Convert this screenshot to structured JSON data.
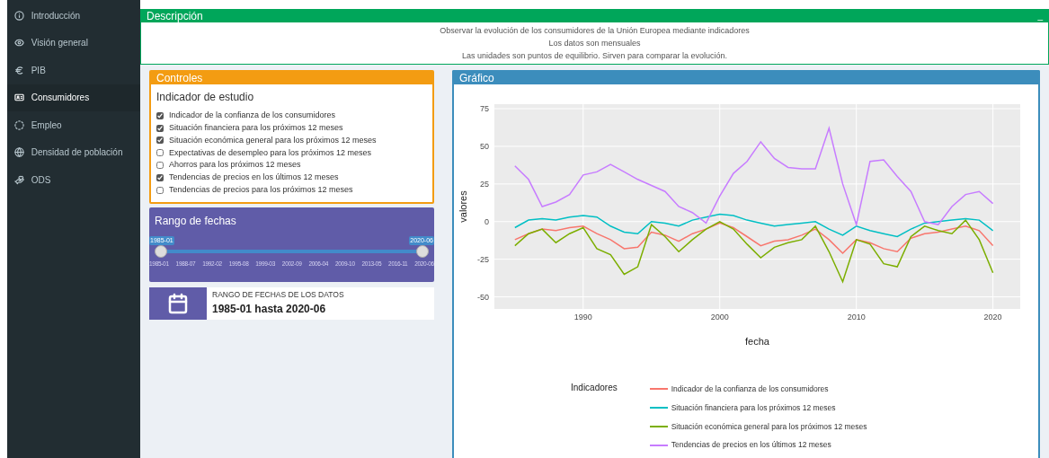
{
  "sidebar": {
    "items": [
      {
        "label": "Introducción",
        "selected": false
      },
      {
        "label": "Visión general",
        "selected": false
      },
      {
        "label": "PIB",
        "selected": false
      },
      {
        "label": "Consumidores",
        "selected": true
      },
      {
        "label": "Empleo",
        "selected": false
      },
      {
        "label": "Densidad de población",
        "selected": false
      },
      {
        "label": "ODS",
        "selected": false
      }
    ]
  },
  "description": {
    "title": "Descripción",
    "collapse_icon": "_",
    "lines": [
      "Observar la evolución de los consumidores de la Unión Europea mediante indicadores",
      "Los datos son mensuales",
      "Las unidades son puntos de equilibrio. Sirven para comparar la evolución."
    ]
  },
  "controls": {
    "title": "Controles",
    "heading": "Indicador de estudio",
    "options": [
      {
        "label": "Indicador de la confianza de los consumidores",
        "checked": true
      },
      {
        "label": "Situación financiera para los próximos 12 meses",
        "checked": true
      },
      {
        "label": "Situación económica general para los próximos 12 meses",
        "checked": true
      },
      {
        "label": "Expectativas de desempleo para los próximos 12 meses",
        "checked": false
      },
      {
        "label": "Ahorros para los próximos 12 meses",
        "checked": false
      },
      {
        "label": "Tendencias de precios en los últimos 12 meses",
        "checked": true
      },
      {
        "label": "Tendencias de precios para los próximos 12 meses",
        "checked": false
      }
    ]
  },
  "date_range": {
    "title": "Rango de fechas",
    "from": "1985-01",
    "to": "2020-06",
    "ticks": [
      "1985-01",
      "1988-07",
      "1992-02",
      "1995-08",
      "1999-03",
      "2002-09",
      "2006-04",
      "2009-10",
      "2013-05",
      "2016-11",
      "2020-06"
    ]
  },
  "info_box": {
    "label": "RANGO DE FECHAS DE LOS DATOS",
    "value": "1985-01 hasta 2020-06"
  },
  "chart_panel": {
    "title": "Gráfico",
    "legend_title": "Indicadores",
    "chart_data": {
      "type": "line",
      "grid": true,
      "xlabel": "fecha",
      "ylabel": "valores",
      "xlim": [
        1983.5,
        2022
      ],
      "ylim": [
        -58,
        78
      ],
      "xticks": [
        1990,
        2000,
        2010,
        2020
      ],
      "yticks": [
        -50,
        -25,
        0,
        25,
        50,
        75
      ],
      "x": [
        1985,
        1986,
        1987,
        1988,
        1989,
        1990,
        1991,
        1992,
        1993,
        1994,
        1995,
        1996,
        1997,
        1998,
        1999,
        2000,
        2001,
        2002,
        2003,
        2004,
        2005,
        2006,
        2007,
        2008,
        2009,
        2010,
        2011,
        2012,
        2013,
        2014,
        2015,
        2016,
        2017,
        2018,
        2019,
        2020
      ],
      "series": [
        {
          "name": "Indicador de la confianza de los consumidores",
          "color": "#f8766d",
          "values": [
            -12,
            -8,
            -5,
            -6,
            -4,
            -3,
            -8,
            -12,
            -18,
            -17,
            -7,
            -9,
            -13,
            -8,
            -5,
            -1,
            -4,
            -10,
            -16,
            -13,
            -12,
            -9,
            -5,
            -12,
            -21,
            -12,
            -14,
            -18,
            -20,
            -11,
            -8,
            -7,
            -5,
            -3,
            -6,
            -16
          ]
        },
        {
          "name": "Situación financiera para los próximos 12 meses",
          "color": "#00bfc4",
          "values": [
            -4,
            1,
            2,
            1,
            3,
            4,
            3,
            -3,
            -7,
            -8,
            0,
            -1,
            -3,
            1,
            3,
            5,
            4,
            1,
            -1,
            -3,
            -2,
            -1,
            0,
            -5,
            -9,
            -3,
            -6,
            -8,
            -10,
            -5,
            -1,
            0,
            1,
            2,
            1,
            -6
          ]
        },
        {
          "name": "Situación económica general para los próximos 12 meses",
          "color": "#7cae00",
          "values": [
            -16,
            -8,
            -5,
            -14,
            -8,
            -4,
            -18,
            -22,
            -35,
            -30,
            -2,
            -10,
            -20,
            -12,
            -5,
            0,
            -5,
            -15,
            -24,
            -17,
            -14,
            -12,
            -3,
            -20,
            -40,
            -12,
            -15,
            -28,
            -30,
            -10,
            -3,
            -6,
            -8,
            1,
            -12,
            -34
          ]
        },
        {
          "name": "Tendencias de precios en los últimos 12 meses",
          "color": "#c77cff",
          "values": [
            37,
            28,
            10,
            13,
            18,
            31,
            33,
            38,
            33,
            28,
            24,
            20,
            10,
            6,
            -1,
            17,
            32,
            40,
            53,
            42,
            36,
            35,
            35,
            62,
            25,
            -2,
            40,
            41,
            30,
            20,
            0,
            -2,
            10,
            18,
            20,
            12
          ]
        }
      ]
    }
  }
}
